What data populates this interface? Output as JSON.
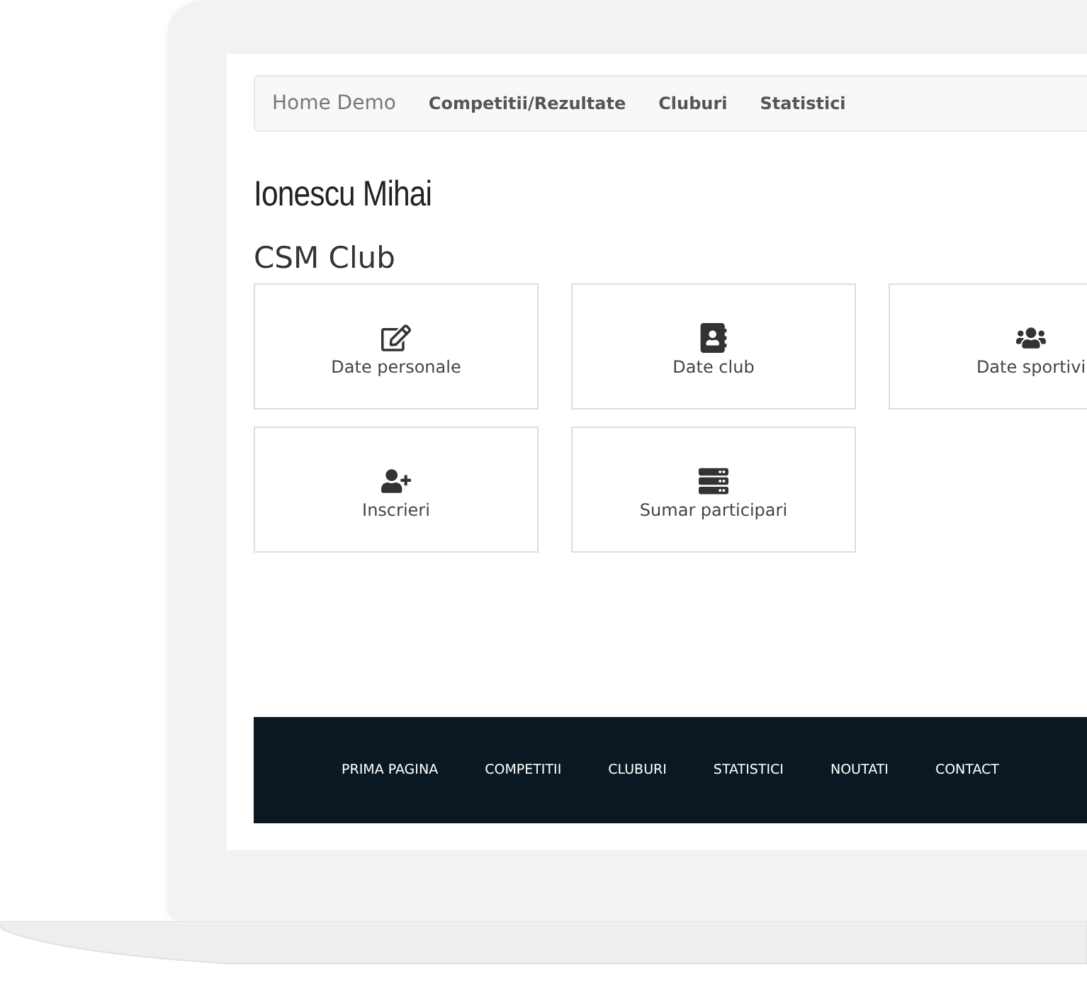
{
  "navbar": {
    "brand": "Home Demo",
    "links": [
      "Competitii/Rezultate",
      "Cluburi",
      "Statistici"
    ]
  },
  "user_name": "Ionescu Mihai",
  "club_title": "CSM Club",
  "tiles": [
    {
      "label": "Date personale",
      "kind": "edit"
    },
    {
      "label": "Date club",
      "kind": "contact-book"
    },
    {
      "label": "Date sportivi",
      "kind": "users"
    },
    {
      "label": "Inscrieri",
      "kind": "user-plus"
    },
    {
      "label": "Sumar participari",
      "kind": "server"
    }
  ],
  "footer": {
    "links": [
      "PRIMA PAGINA",
      "COMPETITII",
      "CLUBURI",
      "STATISTICI",
      "NOUTATI",
      "CONTACT"
    ]
  }
}
